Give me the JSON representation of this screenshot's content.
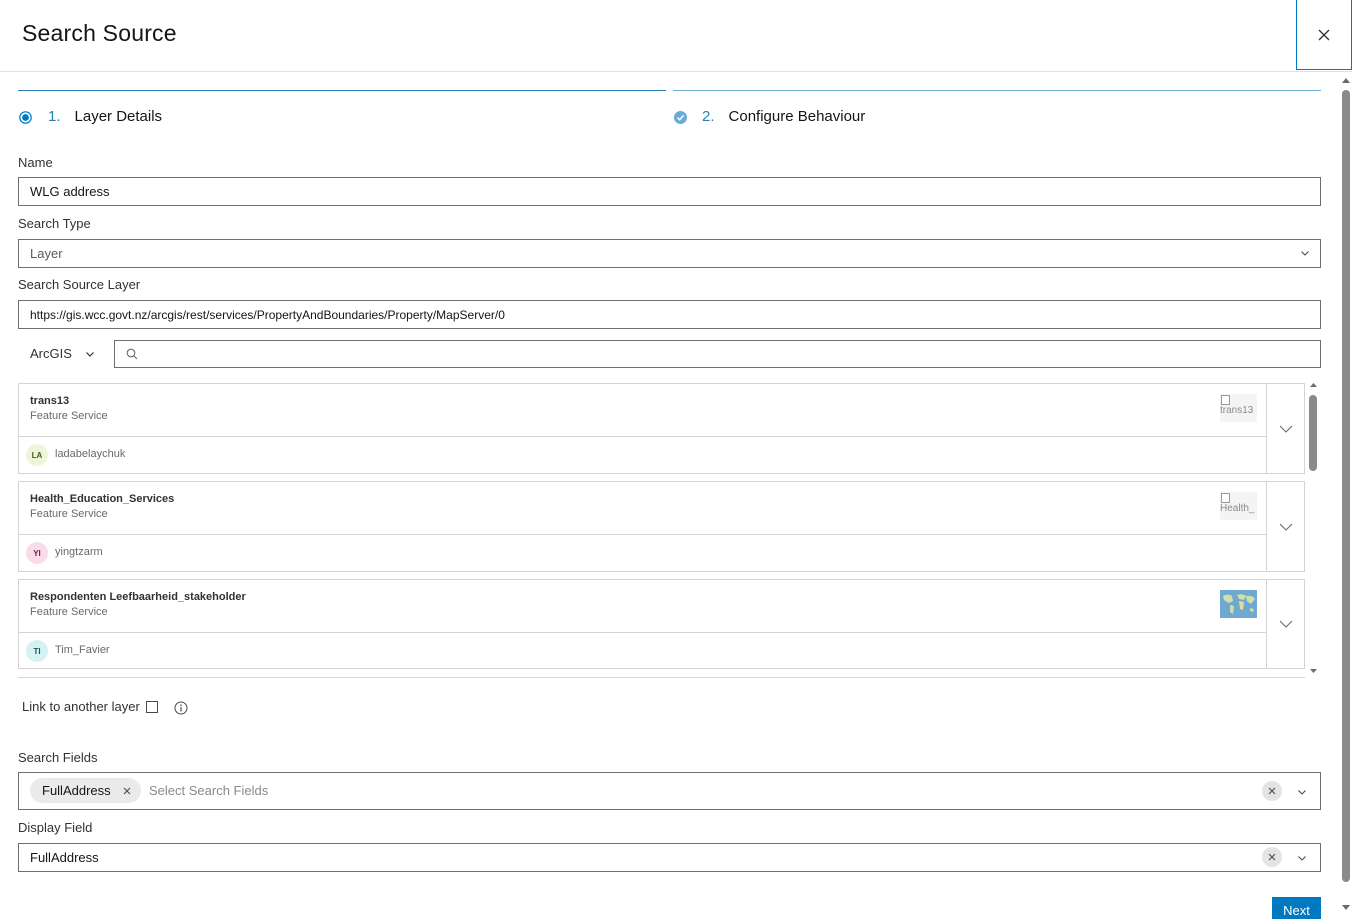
{
  "dialog": {
    "title": "Search Source"
  },
  "stepper": {
    "steps": [
      {
        "number": "1.",
        "label": "Layer Details"
      },
      {
        "number": "2.",
        "label": "Configure Behaviour"
      }
    ]
  },
  "form": {
    "name": {
      "label": "Name",
      "value": "WLG address"
    },
    "search_type": {
      "label": "Search Type",
      "value": "Layer"
    },
    "source_layer": {
      "label": "Search Source Layer",
      "value": "https://gis.wcc.govt.nz/arcgis/rest/services/PropertyAndBoundaries/Property/MapServer/0"
    },
    "portal": {
      "value": "ArcGIS"
    },
    "link_layer": {
      "label": "Link to another layer"
    },
    "search_fields": {
      "label": "Search Fields",
      "chip": "FullAddress",
      "placeholder": "Select Search Fields"
    },
    "display_field": {
      "label": "Display Field",
      "value": "FullAddress"
    }
  },
  "results": [
    {
      "name": "trans13",
      "type": "Feature Service",
      "thumb_alt": "trans13",
      "initials": "LA",
      "user": "ladabelaychuk",
      "avatar_bg": "#eef5d9",
      "avatar_fg": "#4b5a1e"
    },
    {
      "name": "Health_Education_Services",
      "type": "Feature Service",
      "thumb_alt": "Health_",
      "initials": "YI",
      "user": "yingtzarm",
      "avatar_bg": "#f9dbe9",
      "avatar_fg": "#6e1e45"
    },
    {
      "name": "Respondenten Leefbaarheid_stakeholder",
      "type": "Feature Service",
      "thumb_alt": "",
      "initials": "TI",
      "user": "Tim_Favier",
      "avatar_bg": "#d5f1f1",
      "avatar_fg": "#1d5757"
    }
  ],
  "footer": {
    "next_label": "Next"
  },
  "colors": {
    "accent": "#0079c1",
    "step_line": "#2b7fb5"
  }
}
